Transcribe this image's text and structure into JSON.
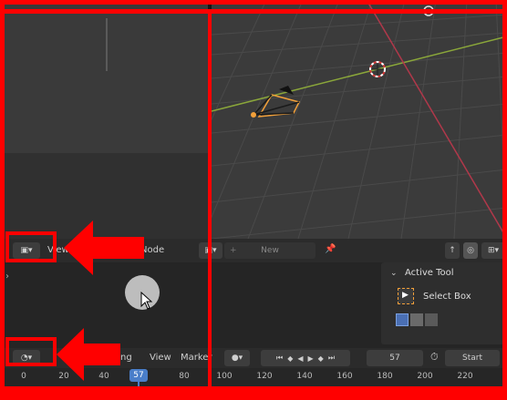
{
  "node_header": {
    "view_label": "View",
    "node_label": "Node",
    "new_label": "New",
    "new_plus": "+"
  },
  "active_tool": {
    "title": "Active Tool",
    "tool_name": "Select Box"
  },
  "timeline": {
    "playback_label": "ng",
    "view_label": "View",
    "marker_label": "Marker",
    "current_frame": "57",
    "start_label": "Start",
    "ticks": [
      "0",
      "20",
      "40",
      "57",
      "80",
      "100",
      "120",
      "140",
      "160",
      "180",
      "200",
      "220"
    ]
  },
  "colors": {
    "annotation_red": "#ff0000",
    "playhead_blue": "#4a7ec9",
    "selection_orange": "#f2a03a"
  },
  "icons": {
    "editor_type": "editor-type-icon",
    "timeline_editor": "clock-icon",
    "pin": "pin-icon",
    "select_box": "select-box-icon"
  }
}
